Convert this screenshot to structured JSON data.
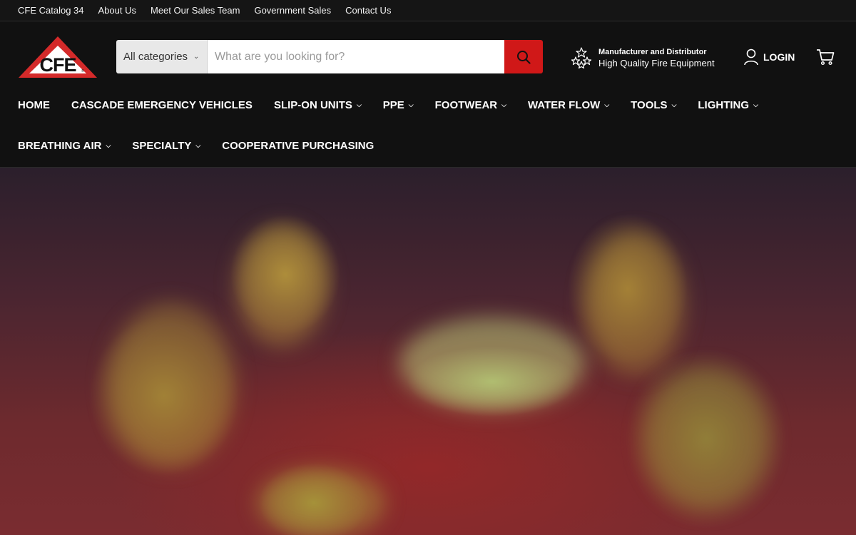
{
  "utility_nav": {
    "links": [
      "CFE Catalog 34",
      "About Us",
      "Meet Our Sales Team",
      "Government Sales",
      "Contact Us"
    ]
  },
  "logo": {
    "text": "CFE",
    "icon": "cfe-triangle-logo",
    "colors": {
      "triangle": "#d42a2a",
      "inner": "#ffffff",
      "letters": "#111111"
    }
  },
  "search": {
    "category": "All categories",
    "placeholder": "What are you looking for?",
    "value": "",
    "button_icon": "search-icon"
  },
  "promo": {
    "icon": "stars-icon",
    "line1": "Manufacturer and Distributor",
    "line2": "High Quality Fire Equipment"
  },
  "account": {
    "label": "LOGIN",
    "icon": "user-icon"
  },
  "cart": {
    "icon": "cart-icon"
  },
  "main_nav": {
    "row1": [
      {
        "label": "HOME",
        "dropdown": false
      },
      {
        "label": "CASCADE EMERGENCY VEHICLES",
        "dropdown": false
      },
      {
        "label": "SLIP-ON UNITS",
        "dropdown": true
      },
      {
        "label": "PPE",
        "dropdown": true
      },
      {
        "label": "FOOTWEAR",
        "dropdown": true
      },
      {
        "label": "WATER FLOW",
        "dropdown": true
      },
      {
        "label": "TOOLS",
        "dropdown": true
      },
      {
        "label": "LIGHTING",
        "dropdown": true
      }
    ],
    "row2": [
      {
        "label": "BREATHING AIR",
        "dropdown": true
      },
      {
        "label": "SPECIALTY",
        "dropdown": true
      },
      {
        "label": "COOPERATIVE PURCHASING",
        "dropdown": false
      }
    ]
  },
  "colors": {
    "header_bg": "#111111",
    "accent_red": "#d01818",
    "text": "#ffffff"
  }
}
